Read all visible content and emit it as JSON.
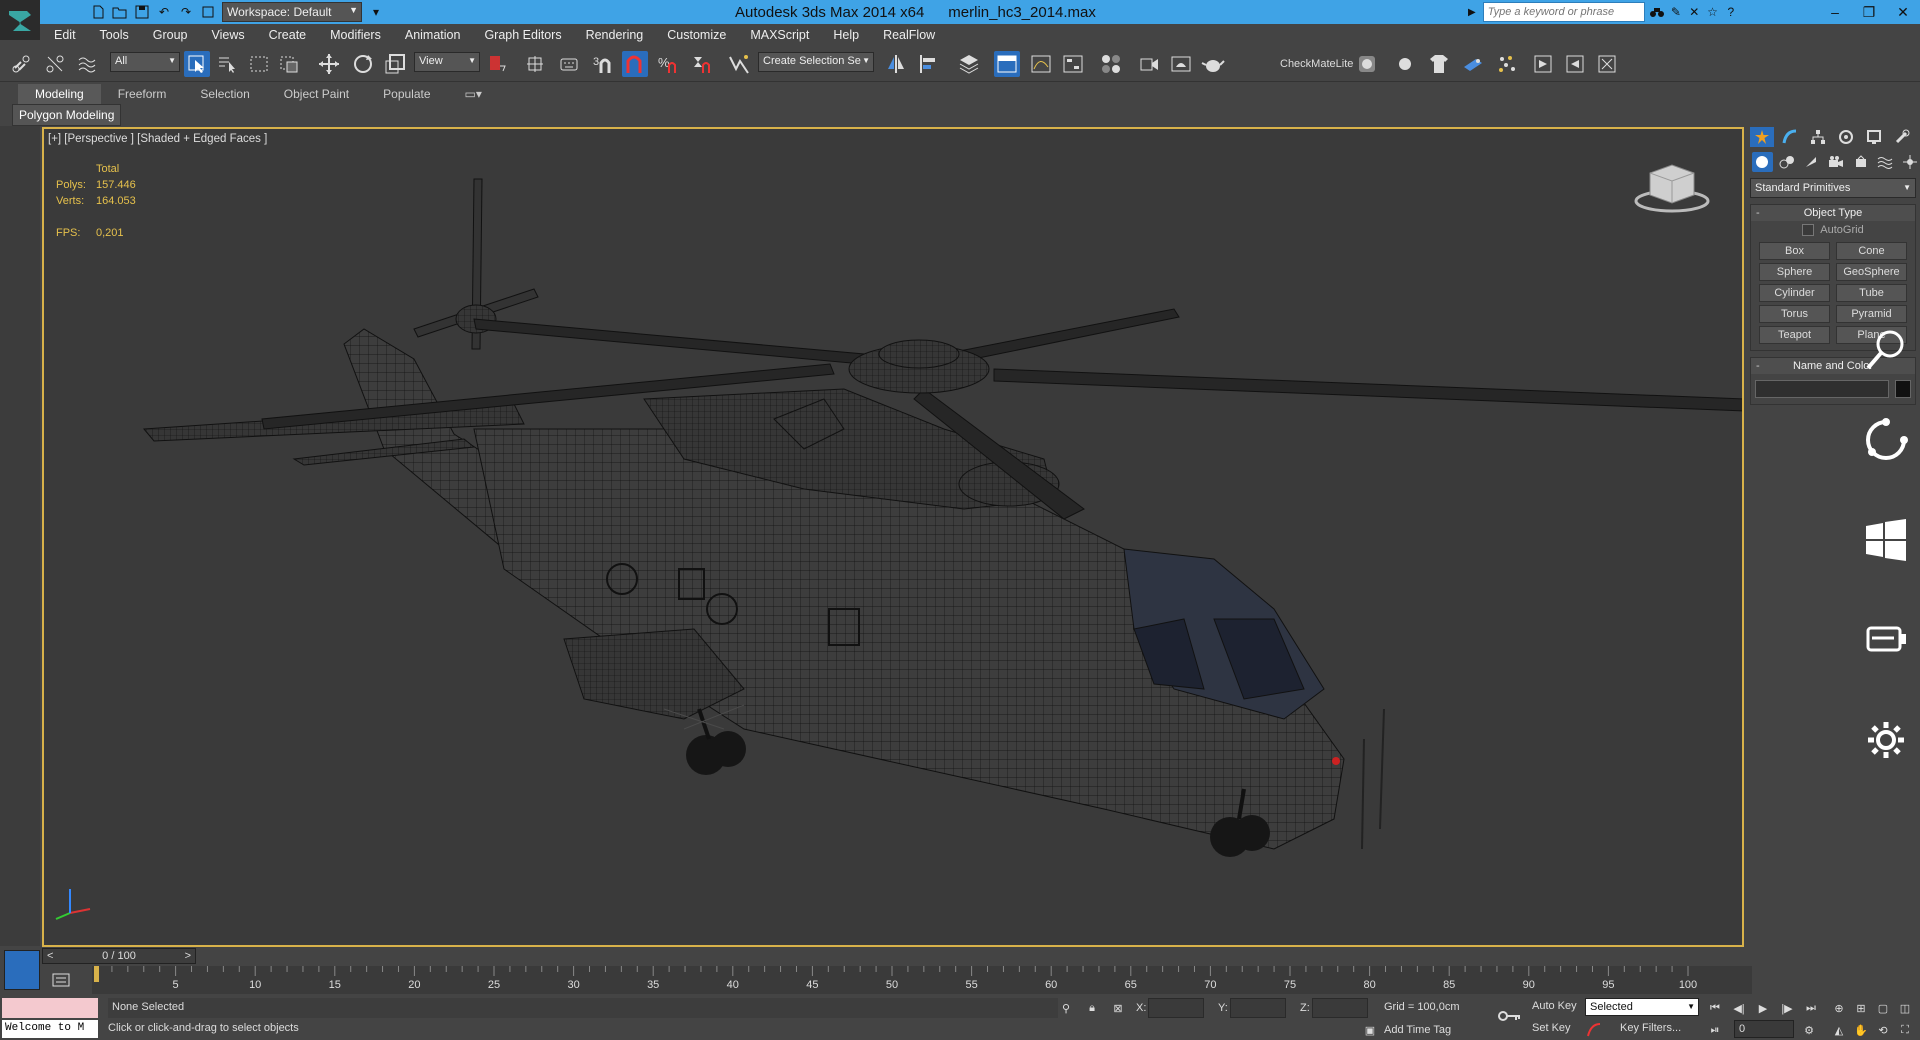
{
  "titlebar": {
    "workspace": "Workspace: Default",
    "app_title": "Autodesk 3ds Max  2014 x64",
    "file_name": "merlin_hc3_2014.max",
    "search_placeholder": "Type a keyword or phrase",
    "accent": "#3fa3e6"
  },
  "menu": [
    "Edit",
    "Tools",
    "Group",
    "Views",
    "Create",
    "Modifiers",
    "Animation",
    "Graph Editors",
    "Rendering",
    "Customize",
    "MAXScript",
    "Help",
    "RealFlow"
  ],
  "toolbar": {
    "selection_filter": "All",
    "ref_coord": "View",
    "named_selection": "Create Selection Se",
    "checkmate": "CheckMateLite",
    "active_color": "#2a6dbc"
  },
  "ribbon": {
    "tabs": [
      "Modeling",
      "Freeform",
      "Selection",
      "Object Paint",
      "Populate"
    ],
    "panel_label": "Polygon Modeling"
  },
  "viewport": {
    "label": "[+] [Perspective ] [Shaded + Edged Faces ]",
    "stats": {
      "total_label": "Total",
      "polys_label": "Polys:",
      "polys": "157.446",
      "verts_label": "Verts:",
      "verts": "164.053",
      "fps_label": "FPS:",
      "fps": "0,201"
    },
    "border_color": "#d8b24a",
    "stat_color": "#e6c14c"
  },
  "command_panel": {
    "category": "Standard Primitives",
    "object_type_title": "Object Type",
    "autogrid": "AutoGrid",
    "primitives": [
      "Box",
      "Cone",
      "Sphere",
      "GeoSphere",
      "Cylinder",
      "Tube",
      "Torus",
      "Pyramid",
      "Teapot",
      "Plane"
    ],
    "name_color_title": "Name and Color"
  },
  "timeline": {
    "frame_label": "0 / 100",
    "ticks": [
      "5",
      "10",
      "15",
      "20",
      "25",
      "30",
      "35",
      "40",
      "45",
      "50",
      "55",
      "60",
      "65",
      "70",
      "75",
      "80",
      "85",
      "90",
      "95",
      "100"
    ]
  },
  "status": {
    "maxscript_text": "Welcome to M",
    "selection": "None Selected",
    "prompt": "Click or click-and-drag to select objects",
    "x_label": "X:",
    "y_label": "Y:",
    "z_label": "Z:",
    "grid": "Grid = 100,0cm",
    "add_time_tag": "Add Time Tag",
    "auto_key": "Auto Key",
    "set_key": "Set Key",
    "key_mode": "Selected",
    "key_filters": "Key Filters...",
    "current_frame": "0"
  }
}
